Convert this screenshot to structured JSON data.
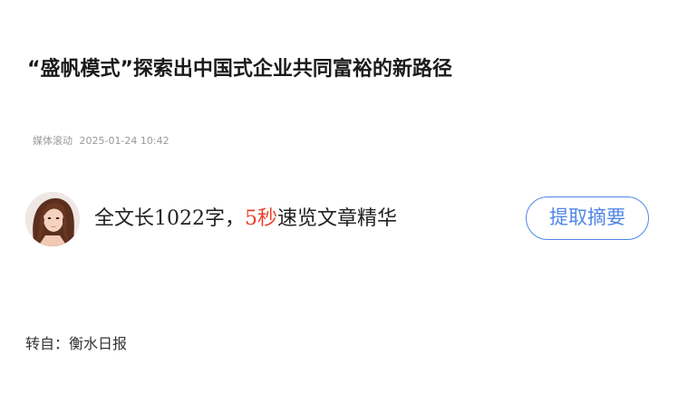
{
  "article": {
    "title": "“盛帆模式”探索出中国式企业共同富裕的新路径",
    "source_tag": "媒体滚动",
    "timestamp": "2025-01-24 10:42"
  },
  "summary": {
    "prefix": "全文长",
    "char_count": "1022",
    "char_unit": "字，",
    "seconds": "5秒",
    "suffix": "速览文章精华",
    "button_label": "提取摘要"
  },
  "source": {
    "label": "转自：",
    "name": "衡水日报"
  }
}
